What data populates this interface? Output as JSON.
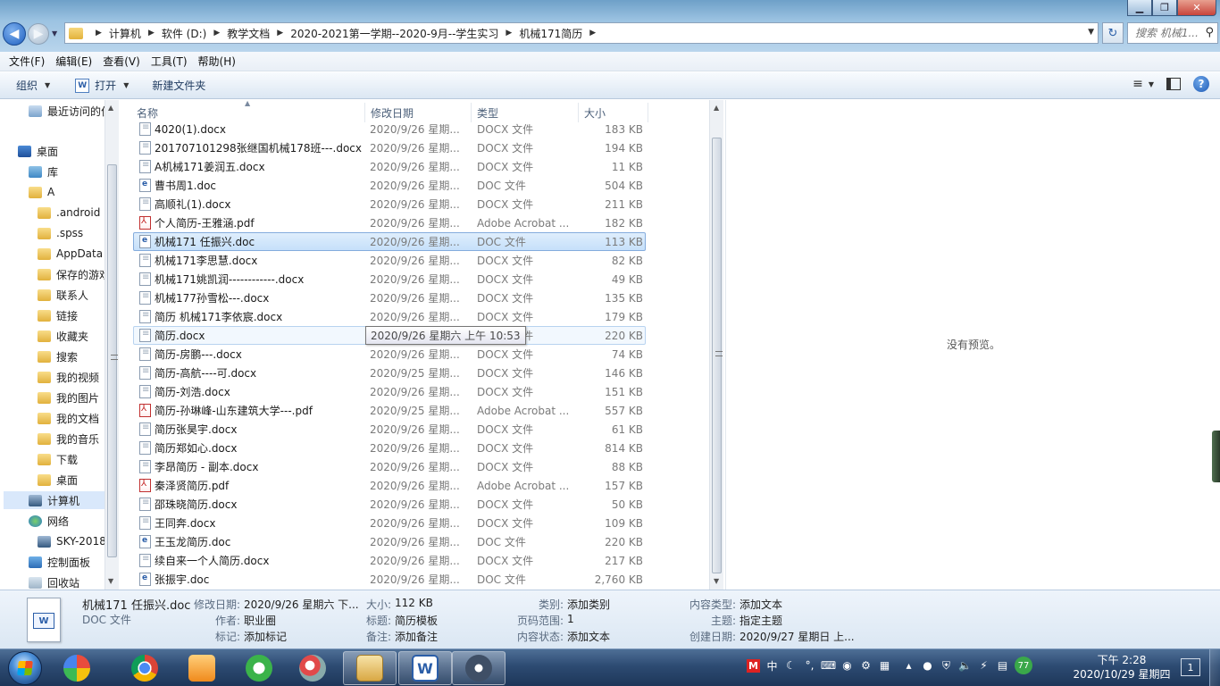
{
  "window": {
    "min_glyph": "▁",
    "max_glyph": "❐",
    "close_glyph": "✕"
  },
  "address": {
    "crumbs": [
      "计算机",
      "软件 (D:)",
      "教学文档",
      "2020-2021第一学期--2020-9月--学生实习",
      "机械171简历"
    ],
    "search_placeholder": "搜索 机械1..."
  },
  "menu": [
    "文件(F)",
    "编辑(E)",
    "查看(V)",
    "工具(T)",
    "帮助(H)"
  ],
  "toolbar": {
    "organize": "组织",
    "open": "打开",
    "new_folder": "新建文件夹"
  },
  "nav": [
    {
      "label": "最近访问的位置",
      "icon": "star"
    },
    {
      "label": "桌面",
      "icon": "desk"
    },
    {
      "label": "库",
      "icon": "lib"
    },
    {
      "label": "A",
      "icon": "folder"
    },
    {
      "label": ".android",
      "icon": "folder"
    },
    {
      "label": ".spss",
      "icon": "folder"
    },
    {
      "label": "AppData",
      "icon": "folder"
    },
    {
      "label": "保存的游戏",
      "icon": "folder"
    },
    {
      "label": "联系人",
      "icon": "folder"
    },
    {
      "label": "链接",
      "icon": "folder"
    },
    {
      "label": "收藏夹",
      "icon": "folder"
    },
    {
      "label": "搜索",
      "icon": "folder"
    },
    {
      "label": "我的视频",
      "icon": "folder"
    },
    {
      "label": "我的图片",
      "icon": "folder"
    },
    {
      "label": "我的文档",
      "icon": "folder"
    },
    {
      "label": "我的音乐",
      "icon": "folder"
    },
    {
      "label": "下载",
      "icon": "folder"
    },
    {
      "label": "桌面",
      "icon": "folder"
    },
    {
      "label": "计算机",
      "icon": "comp"
    },
    {
      "label": "网络",
      "icon": "net"
    },
    {
      "label": "SKY-2018",
      "icon": "comp"
    },
    {
      "label": "控制面板",
      "icon": "panel"
    },
    {
      "label": "回收站",
      "icon": "bin"
    }
  ],
  "columns": {
    "name": "名称",
    "date": "修改日期",
    "type": "类型",
    "size": "大小"
  },
  "files": [
    {
      "name": "4020(1).docx",
      "date": "2020/9/26 星期...",
      "type": "DOCX 文件",
      "size": "183 KB",
      "kind": "docx"
    },
    {
      "name": "201707101298张继国机械178班---.docx",
      "date": "2020/9/26 星期...",
      "type": "DOCX 文件",
      "size": "194 KB",
      "kind": "docx"
    },
    {
      "name": "A机械171姜润五.docx",
      "date": "2020/9/26 星期...",
      "type": "DOCX 文件",
      "size": "11 KB",
      "kind": "docx"
    },
    {
      "name": "曹书周1.doc",
      "date": "2020/9/26 星期...",
      "type": "DOC 文件",
      "size": "504 KB",
      "kind": "doc"
    },
    {
      "name": "高顺礼(1).docx",
      "date": "2020/9/26 星期...",
      "type": "DOCX 文件",
      "size": "211 KB",
      "kind": "docx"
    },
    {
      "name": "个人简历-王雅涵.pdf",
      "date": "2020/9/26 星期...",
      "type": "Adobe Acrobat ...",
      "size": "182 KB",
      "kind": "pdf"
    },
    {
      "name": "机械171 任振兴.doc",
      "date": "2020/9/26 星期...",
      "type": "DOC 文件",
      "size": "113 KB",
      "kind": "doc"
    },
    {
      "name": "机械171李思慧.docx",
      "date": "2020/9/26 星期...",
      "type": "DOCX 文件",
      "size": "82 KB",
      "kind": "docx"
    },
    {
      "name": "机械171姚凯润------------.docx",
      "date": "2020/9/26 星期...",
      "type": "DOCX 文件",
      "size": "49 KB",
      "kind": "docx"
    },
    {
      "name": "机械177孙雪松---.docx",
      "date": "2020/9/26 星期...",
      "type": "DOCX 文件",
      "size": "135 KB",
      "kind": "docx"
    },
    {
      "name": "简历 机械171李依宸.docx",
      "date": "2020/9/26 星期...",
      "type": "DOCX 文件",
      "size": "179 KB",
      "kind": "docx"
    },
    {
      "name": "简历.docx",
      "date": "2020/9/26 星期...",
      "type": "DOCX 文件",
      "size": "220 KB",
      "kind": "docx"
    },
    {
      "name": "简历-房鹏---.docx",
      "date": "2020/9/26 星期...",
      "type": "DOCX 文件",
      "size": "74 KB",
      "kind": "docx"
    },
    {
      "name": "简历-高航----可.docx",
      "date": "2020/9/25 星期...",
      "type": "DOCX 文件",
      "size": "146 KB",
      "kind": "docx"
    },
    {
      "name": "简历-刘浩.docx",
      "date": "2020/9/26 星期...",
      "type": "DOCX 文件",
      "size": "151 KB",
      "kind": "docx"
    },
    {
      "name": "简历-孙琳峰-山东建筑大学---.pdf",
      "date": "2020/9/25 星期...",
      "type": "Adobe Acrobat ...",
      "size": "557 KB",
      "kind": "pdf"
    },
    {
      "name": "简历张昊宇.docx",
      "date": "2020/9/26 星期...",
      "type": "DOCX 文件",
      "size": "61 KB",
      "kind": "docx"
    },
    {
      "name": "简历郑如心.docx",
      "date": "2020/9/26 星期...",
      "type": "DOCX 文件",
      "size": "814 KB",
      "kind": "docx"
    },
    {
      "name": "李昂简历 - 副本.docx",
      "date": "2020/9/26 星期...",
      "type": "DOCX 文件",
      "size": "88 KB",
      "kind": "docx"
    },
    {
      "name": "秦泽贤简历.pdf",
      "date": "2020/9/26 星期...",
      "type": "Adobe Acrobat ...",
      "size": "157 KB",
      "kind": "pdf"
    },
    {
      "name": "邵珠晓简历.docx",
      "date": "2020/9/26 星期...",
      "type": "DOCX 文件",
      "size": "50 KB",
      "kind": "docx"
    },
    {
      "name": "王同奔.docx",
      "date": "2020/9/26 星期...",
      "type": "DOCX 文件",
      "size": "109 KB",
      "kind": "docx"
    },
    {
      "name": "王玉龙简历.doc",
      "date": "2020/9/26 星期...",
      "type": "DOC 文件",
      "size": "220 KB",
      "kind": "doc"
    },
    {
      "name": "续自来一个人简历.docx",
      "date": "2020/9/26 星期...",
      "type": "DOCX 文件",
      "size": "217 KB",
      "kind": "docx"
    },
    {
      "name": "张振宇.doc",
      "date": "2020/9/26 星期...",
      "type": "DOC 文件",
      "size": "2,760 KB",
      "kind": "doc"
    }
  ],
  "tooltip": "2020/9/26 星期六 上午 10:53",
  "preview": {
    "message": "没有预览。"
  },
  "details": {
    "filename": "机械171 任振兴.doc",
    "filetype": "DOC 文件",
    "modified_label": "修改日期:",
    "modified_value": "2020/9/26 星期六 下...",
    "size_label": "大小:",
    "size_value": "112 KB",
    "category_label": "类别:",
    "category_value": "添加类别",
    "content_type_label": "内容类型:",
    "content_type_value": "添加文本",
    "author_label": "作者:",
    "author_value": "职业圈",
    "title_label": "标题:",
    "title_value": "简历模板",
    "page_range_label": "页码范围:",
    "page_range_value": "1",
    "subject_label": "主题:",
    "subject_value": "指定主题",
    "tags_label": "标记:",
    "tags_value": "添加标记",
    "comments_label": "备注:",
    "comments_value": "添加备注",
    "content_status_label": "内容状态:",
    "content_status_value": "添加文本",
    "created_label": "创建日期:",
    "created_value": "2020/9/27 星期日 上..."
  },
  "taskbar": {
    "tray_badge": "77",
    "ime_text": "中",
    "clock_time": "下午 2:28",
    "clock_date": "2020/10/29 星期四",
    "notif_count": "1"
  }
}
